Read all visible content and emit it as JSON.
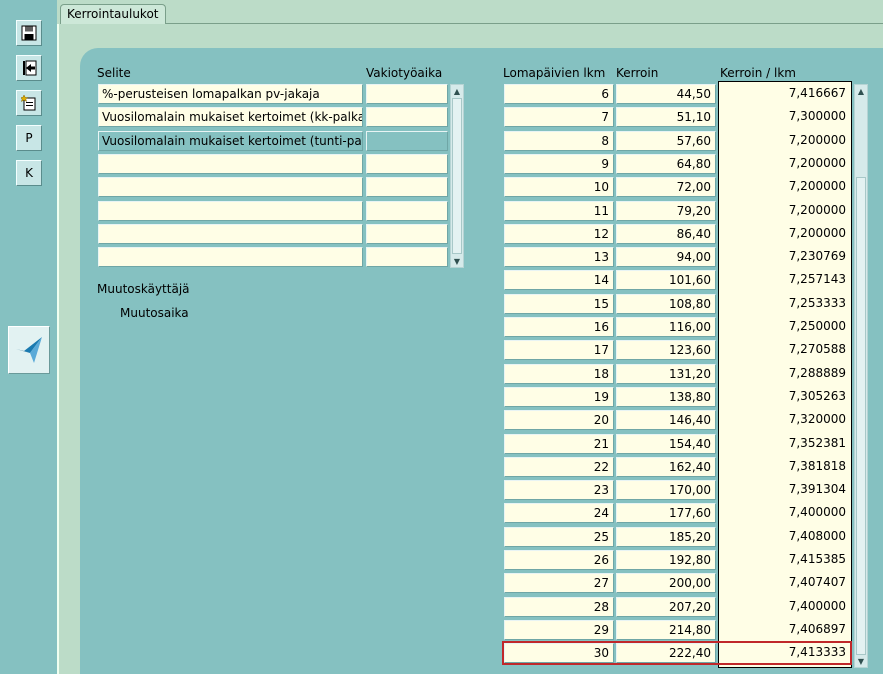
{
  "toolbar": {
    "save_icon": "save-icon",
    "exit_icon": "exit-icon",
    "new_icon": "new-document-icon",
    "p_label": "P",
    "k_label": "K",
    "logo_icon": "app-logo-icon"
  },
  "tab": {
    "label": "Kerrointaulukot"
  },
  "left_table": {
    "headers": {
      "selite": "Selite",
      "vakiotyoaika": "Vakiotyöaika"
    },
    "rows": [
      {
        "selite": "%-perusteisen lomapalkan pv-jakaja",
        "vakio": ""
      },
      {
        "selite": "Vuosilomalain mukaiset kertoimet (kk-palkat)",
        "vakio": ""
      },
      {
        "selite": "Vuosilomalain mukaiset kertoimet (tunti-palkat)",
        "vakio": ""
      },
      {
        "selite": "",
        "vakio": ""
      },
      {
        "selite": "",
        "vakio": ""
      },
      {
        "selite": "",
        "vakio": ""
      },
      {
        "selite": "",
        "vakio": ""
      },
      {
        "selite": "",
        "vakio": ""
      }
    ],
    "selected_row": 2
  },
  "info": {
    "muutoskayttaja": "Muutoskäyttäjä",
    "muutosaika": "Muutosaika"
  },
  "right_table": {
    "headers": {
      "days": "Lomapäivien lkm",
      "coef": "Kerroin",
      "ratio": "Kerroin / lkm"
    },
    "rows": [
      [
        "6",
        "44,50",
        "7,416667"
      ],
      [
        "7",
        "51,10",
        "7,300000"
      ],
      [
        "8",
        "57,60",
        "7,200000"
      ],
      [
        "9",
        "64,80",
        "7,200000"
      ],
      [
        "10",
        "72,00",
        "7,200000"
      ],
      [
        "11",
        "79,20",
        "7,200000"
      ],
      [
        "12",
        "86,40",
        "7,200000"
      ],
      [
        "13",
        "94,00",
        "7,230769"
      ],
      [
        "14",
        "101,60",
        "7,257143"
      ],
      [
        "15",
        "108,80",
        "7,253333"
      ],
      [
        "16",
        "116,00",
        "7,250000"
      ],
      [
        "17",
        "123,60",
        "7,270588"
      ],
      [
        "18",
        "131,20",
        "7,288889"
      ],
      [
        "19",
        "138,80",
        "7,305263"
      ],
      [
        "20",
        "146,40",
        "7,320000"
      ],
      [
        "21",
        "154,40",
        "7,352381"
      ],
      [
        "22",
        "162,40",
        "7,381818"
      ],
      [
        "23",
        "170,00",
        "7,391304"
      ],
      [
        "24",
        "177,60",
        "7,400000"
      ],
      [
        "25",
        "185,20",
        "7,408000"
      ],
      [
        "26",
        "192,80",
        "7,415385"
      ],
      [
        "27",
        "200,00",
        "7,407407"
      ],
      [
        "28",
        "207,20",
        "7,400000"
      ],
      [
        "29",
        "214,80",
        "7,406897"
      ],
      [
        "30",
        "222,40",
        "7,413333"
      ]
    ],
    "highlighted_row": 24
  },
  "colors": {
    "background": "#85c1c1",
    "band": "#bcdcc8",
    "field": "#fffee6",
    "highlight": "#c0282a"
  }
}
